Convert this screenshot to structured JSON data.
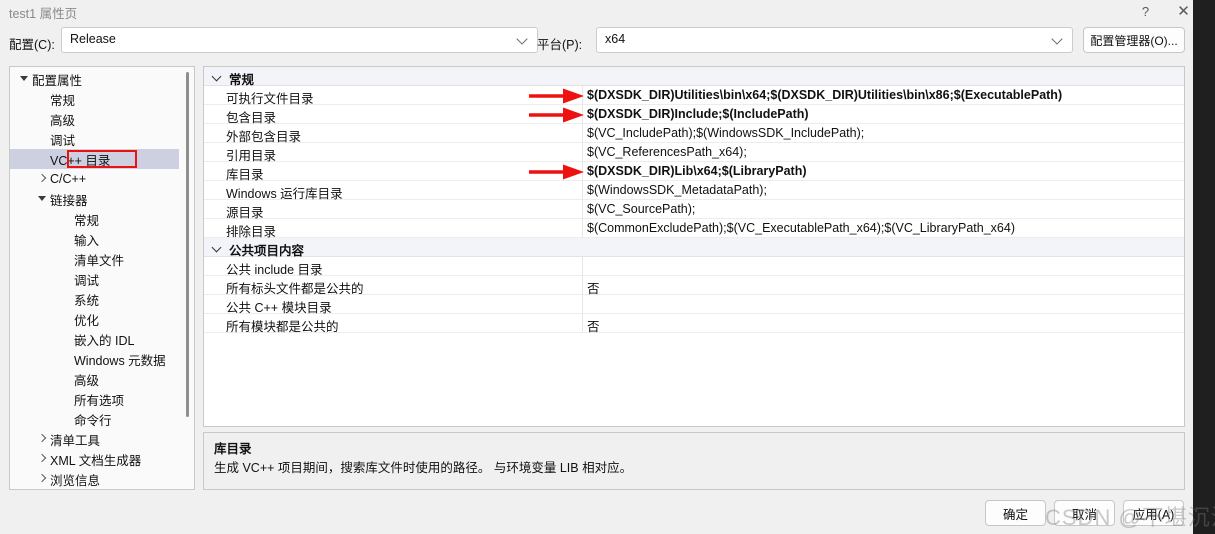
{
  "window": {
    "title": "test1 属性页",
    "help_icon": "?",
    "close_icon": "✕"
  },
  "toolbar": {
    "config_label": "配置(C):",
    "config_value": "Release",
    "platform_label": "平台(P):",
    "platform_value": "x64",
    "config_manager_label": "配置管理器(O)..."
  },
  "tree": {
    "nodes": [
      {
        "label": "配置属性",
        "indent": 0,
        "expander": "open",
        "selected": false
      },
      {
        "label": "常规",
        "indent": 1,
        "expander": "none",
        "selected": false
      },
      {
        "label": "高级",
        "indent": 1,
        "expander": "none",
        "selected": false
      },
      {
        "label": "调试",
        "indent": 1,
        "expander": "none",
        "selected": false
      },
      {
        "label": "VC++ 目录",
        "indent": 1,
        "expander": "none",
        "selected": true
      },
      {
        "label": "C/C++",
        "indent": 1,
        "expander": "closed",
        "selected": false
      },
      {
        "label": "链接器",
        "indent": 1,
        "expander": "open",
        "selected": false
      },
      {
        "label": "常规",
        "indent": 2,
        "expander": "none",
        "selected": false
      },
      {
        "label": "输入",
        "indent": 2,
        "expander": "none",
        "selected": false
      },
      {
        "label": "清单文件",
        "indent": 2,
        "expander": "none",
        "selected": false
      },
      {
        "label": "调试",
        "indent": 2,
        "expander": "none",
        "selected": false
      },
      {
        "label": "系统",
        "indent": 2,
        "expander": "none",
        "selected": false
      },
      {
        "label": "优化",
        "indent": 2,
        "expander": "none",
        "selected": false
      },
      {
        "label": "嵌入的 IDL",
        "indent": 2,
        "expander": "none",
        "selected": false
      },
      {
        "label": "Windows 元数据",
        "indent": 2,
        "expander": "none",
        "selected": false
      },
      {
        "label": "高级",
        "indent": 2,
        "expander": "none",
        "selected": false
      },
      {
        "label": "所有选项",
        "indent": 2,
        "expander": "none",
        "selected": false
      },
      {
        "label": "命令行",
        "indent": 2,
        "expander": "none",
        "selected": false
      },
      {
        "label": "清单工具",
        "indent": 1,
        "expander": "closed",
        "selected": false
      },
      {
        "label": "XML 文档生成器",
        "indent": 1,
        "expander": "closed",
        "selected": false
      },
      {
        "label": "浏览信息",
        "indent": 1,
        "expander": "closed",
        "selected": false
      }
    ]
  },
  "grid": {
    "sections": [
      {
        "title": "常规",
        "rows": [
          {
            "name": "可执行文件目录",
            "value": "$(DXSDK_DIR)Utilities\\bin\\x64;$(DXSDK_DIR)Utilities\\bin\\x86;$(ExecutablePath)",
            "bold": true,
            "arrow": true
          },
          {
            "name": "包含目录",
            "value": "$(DXSDK_DIR)Include;$(IncludePath)",
            "bold": true,
            "arrow": true
          },
          {
            "name": "外部包含目录",
            "value": "$(VC_IncludePath);$(WindowsSDK_IncludePath);",
            "bold": false,
            "arrow": false
          },
          {
            "name": "引用目录",
            "value": "$(VC_ReferencesPath_x64);",
            "bold": false,
            "arrow": false
          },
          {
            "name": "库目录",
            "value": "$(DXSDK_DIR)Lib\\x64;$(LibraryPath)",
            "bold": true,
            "arrow": true
          },
          {
            "name": "Windows 运行库目录",
            "value": "$(WindowsSDK_MetadataPath);",
            "bold": false,
            "arrow": false
          },
          {
            "name": "源目录",
            "value": "$(VC_SourcePath);",
            "bold": false,
            "arrow": false
          },
          {
            "name": "排除目录",
            "value": "$(CommonExcludePath);$(VC_ExecutablePath_x64);$(VC_LibraryPath_x64)",
            "bold": false,
            "arrow": false
          }
        ]
      },
      {
        "title": "公共项目内容",
        "rows": [
          {
            "name": "公共 include 目录",
            "value": "",
            "bold": false,
            "arrow": false
          },
          {
            "name": "所有标头文件都是公共的",
            "value": "否",
            "bold": false,
            "arrow": false
          },
          {
            "name": "公共 C++ 模块目录",
            "value": "",
            "bold": false,
            "arrow": false
          },
          {
            "name": "所有模块都是公共的",
            "value": "否",
            "bold": false,
            "arrow": false
          }
        ]
      }
    ]
  },
  "description": {
    "title": "库目录",
    "body": "生成 VC++ 项目期间，搜索库文件时使用的路径。  与环境变量 LIB 相对应。"
  },
  "footer": {
    "ok_label": "确定",
    "cancel_label": "取消",
    "apply_label": "应用(A)"
  },
  "watermark": {
    "text": "CSDN @不堪沉沦"
  },
  "colors": {
    "selection": "#cdd0e0",
    "annotation_red": "#ee1111",
    "category_bg": "#f2f4fa",
    "dialog_bg": "#f0f0f0"
  }
}
